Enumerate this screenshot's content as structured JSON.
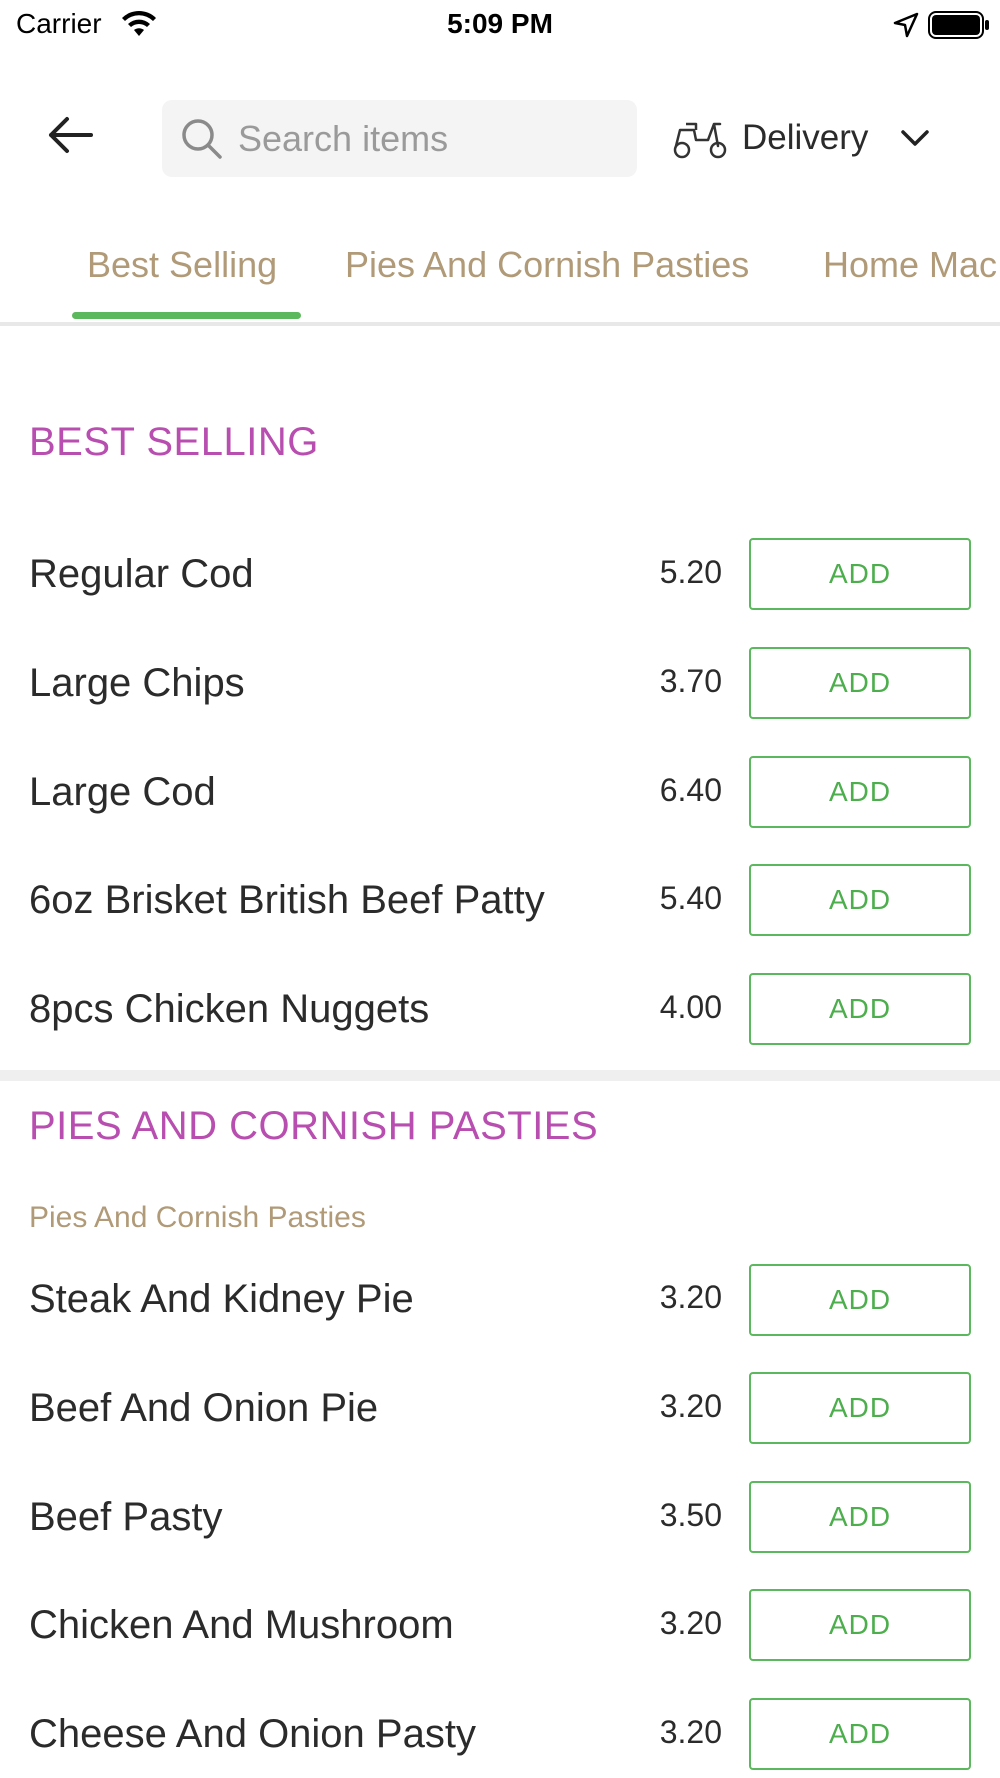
{
  "status_bar": {
    "carrier": "Carrier",
    "time": "5:09 PM"
  },
  "header": {
    "search_placeholder": "Search items",
    "delivery_label": "Delivery"
  },
  "tabs": [
    {
      "label": "Best Selling",
      "active": true
    },
    {
      "label": "Pies And Cornish Pasties",
      "active": false
    },
    {
      "label": "Home Mac",
      "active": false
    }
  ],
  "accent_colors": {
    "active_tab": "#5cb85c",
    "section_title": "#b84fb0",
    "tab_text": "#b09a78",
    "add_button": "#4cae4c"
  },
  "sections": [
    {
      "title": "BEST SELLING",
      "items": [
        {
          "name": "Regular Cod",
          "price": "5.20",
          "button": "ADD"
        },
        {
          "name": "Large Chips",
          "price": "3.70",
          "button": "ADD"
        },
        {
          "name": "Large Cod",
          "price": "6.40",
          "button": "ADD"
        },
        {
          "name": "6oz Brisket British Beef Patty",
          "price": "5.40",
          "button": "ADD"
        },
        {
          "name": "8pcs Chicken Nuggets",
          "price": "4.00",
          "button": "ADD"
        }
      ]
    },
    {
      "title": "PIES AND CORNISH PASTIES",
      "subtitle": "Pies And Cornish Pasties",
      "items": [
        {
          "name": "Steak And Kidney Pie",
          "price": "3.20",
          "button": "ADD"
        },
        {
          "name": "Beef And Onion Pie",
          "price": "3.20",
          "button": "ADD"
        },
        {
          "name": "Beef Pasty",
          "price": "3.50",
          "button": "ADD"
        },
        {
          "name": "Chicken And Mushroom",
          "price": "3.20",
          "button": "ADD"
        },
        {
          "name": "Cheese And Onion Pasty",
          "price": "3.20",
          "button": "ADD"
        }
      ]
    }
  ]
}
